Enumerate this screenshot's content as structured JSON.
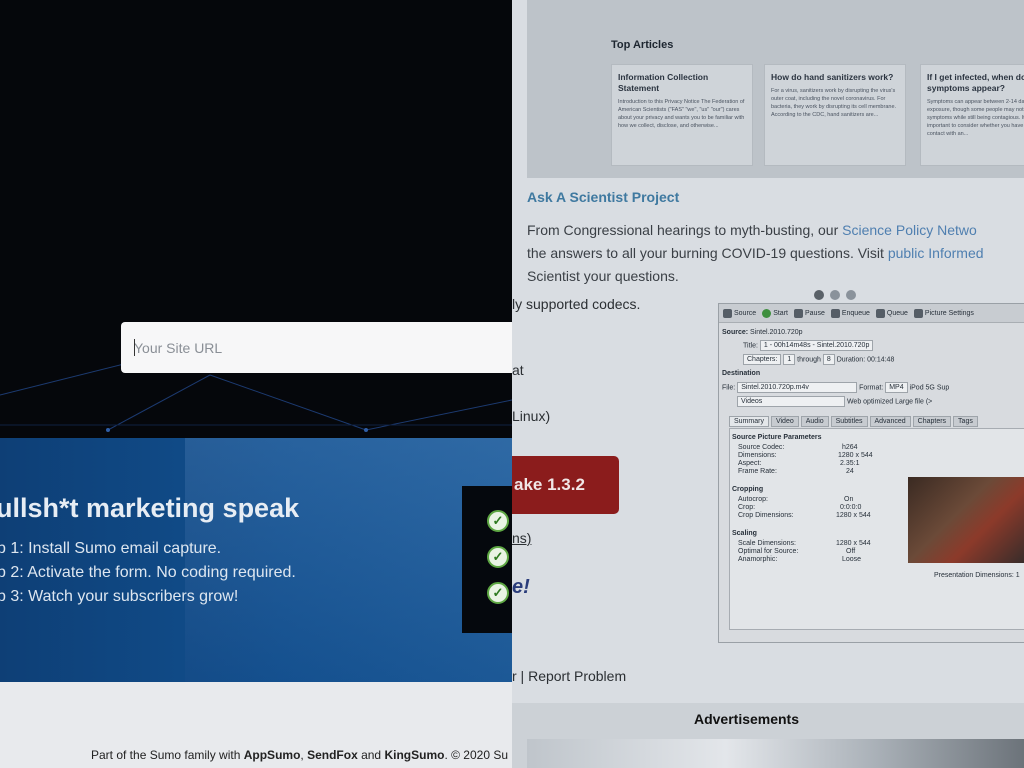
{
  "sumo": {
    "url_placeholder": "Your Site URL",
    "headline": "ullsh*t marketing speak",
    "steps": [
      "p 1: Install Sumo email capture.",
      "p 2: Activate the form. No coding required.",
      "p 3: Watch your subscribers grow!"
    ],
    "footer": {
      "prefix": "Part of the Sumo family with ",
      "brand1": "AppSumo",
      "sep1": ", ",
      "brand2": "SendFox",
      "sep2": " and ",
      "brand3": "KingSumo",
      "suffix": ". © 2020 Su"
    }
  },
  "background_site": {
    "top_articles": {
      "heading": "Top Articles",
      "cards": [
        {
          "title": "Information Collection Statement",
          "body": "Introduction to this Privacy Notice The Federation of American Scientists (\"FAS\" \"we\", \"us\" \"our\") cares about your privacy and wants you to be familiar with how we collect, disclose, and otherwise..."
        },
        {
          "title": "How do hand sanitizers work?",
          "body": "For a virus, sanitizers work by disrupting the virus's outer coat, including the novel coronavirus. For bacteria, they work by disrupting its cell membrane. According to the CDC, hand sanitizers are..."
        },
        {
          "title": "If I get infected, when do symptoms appear?",
          "body": "Symptoms can appear between 2-14 days after exposure, though some people may not have any symptoms while still being contagious. It is also important to consider whether you have been in contact with an..."
        }
      ]
    },
    "garbled_title": "Ask A Scientist Project",
    "garbled_lines": [
      {
        "dark": "From Congressional hearings to myth-busting, our ",
        "blue": "Science Policy Netwo"
      },
      {
        "dark": "the answers to all your burning COVID-19 questions. Visit ",
        "blue": "public Informed"
      }
    ],
    "garbled_tail": "Scientist your questions.",
    "supported_text": "ly supported codecs.",
    "frag_at": "at",
    "frag_linux": "Linux)",
    "download_button": "ake 1.3.2",
    "frag_ns": "ns)",
    "frag_e": "e!",
    "footer_links": "r | Report Problem",
    "ads_label": "Advertisements",
    "handbrake": {
      "toolbar": [
        "Source",
        "Start",
        "Pause",
        "Enqueue",
        "Queue",
        "Picture Settings"
      ],
      "source_label": "Source:",
      "source_value": "Sintel.2010.720p",
      "title_label": "Title:",
      "title_value": "1 - 00h14m48s - Sintel.2010.720p",
      "chapters_label": "Chapters:",
      "chapter_from": "1",
      "through_label": "through",
      "chapter_to": "8",
      "duration_label": "Duration:",
      "duration_value": "00:14:48",
      "destination_label": "Destination",
      "file_label": "File:",
      "file_value": "Sintel.2010.720p.m4v",
      "format_label": "Format:",
      "format_value": "MP4",
      "ipod_label": "iPod 5G Sup",
      "folder_value": "Videos",
      "web_opt_label": "Web optimized",
      "large_file_label": "Large file (>",
      "tabs": [
        "Summary",
        "Video",
        "Audio",
        "Subtitles",
        "Advanced",
        "Chapters",
        "Tags"
      ],
      "source_params_heading": "Source Picture Parameters",
      "source_params": [
        {
          "label": "Source Codec:",
          "value": "h264"
        },
        {
          "label": "Dimensions:",
          "value": "1280 x 544"
        },
        {
          "label": "Aspect:",
          "value": "2.35:1"
        },
        {
          "label": "Frame Rate:",
          "value": "24"
        }
      ],
      "cropping_heading": "Cropping",
      "cropping": [
        {
          "label": "Autocrop:",
          "value": "On"
        },
        {
          "label": "Crop:",
          "value": "0:0:0:0"
        },
        {
          "label": "Crop Dimensions:",
          "value": "1280 x 544"
        }
      ],
      "scaling_heading": "Scaling",
      "scaling": [
        {
          "label": "Scale Dimensions:",
          "value": "1280 x 544"
        },
        {
          "label": "Optimal for Source:",
          "value": "Off"
        },
        {
          "label": "Anamorphic:",
          "value": "Loose"
        }
      ],
      "presentation_dims": "Presentation Dimensions: 1"
    }
  },
  "colors": {
    "hero_bg": "#05070b",
    "band_blue": "#11508f",
    "download_red": "#8b1c1c",
    "check_green": "#5ea743",
    "link_blue": "#3f79a0"
  }
}
